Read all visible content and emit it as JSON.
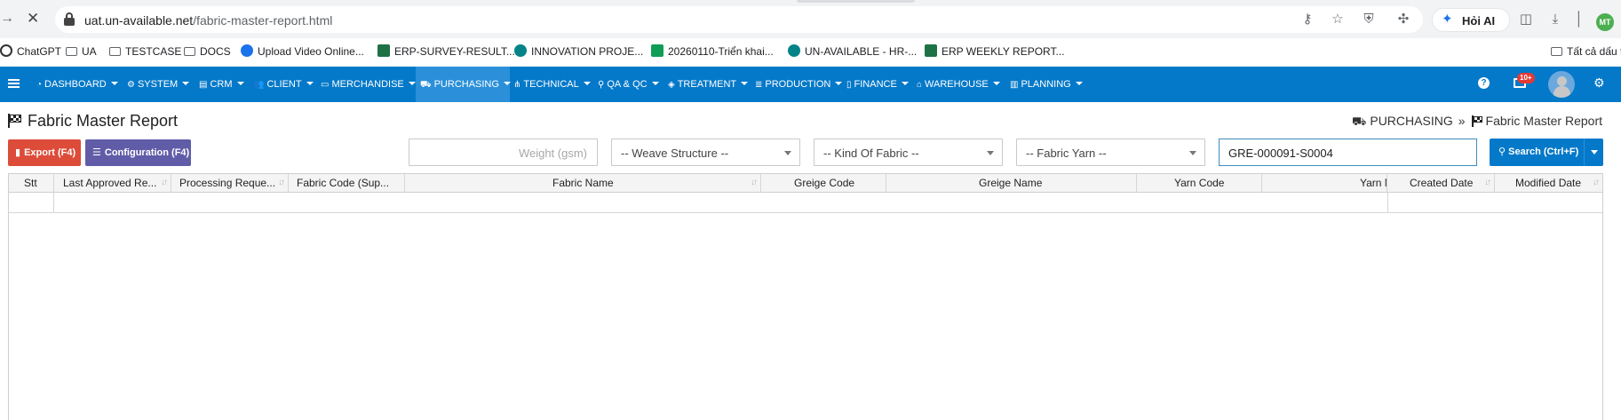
{
  "browser": {
    "url_host": "uat.un-available.net",
    "url_path": "/fabric-master-report.html",
    "ai_button_label": "Hỏi AI",
    "profile_initials": "MT",
    "icons": [
      "key-icon",
      "star-icon",
      "shield-icon",
      "extension-icon",
      "split-view-icon",
      "download-icon"
    ]
  },
  "bookmarks": [
    {
      "label": "ChatGPT",
      "icon": "chatgpt-icon"
    },
    {
      "label": "UA",
      "icon": "folder-icon"
    },
    {
      "label": "TESTCASE",
      "icon": "folder-icon"
    },
    {
      "label": "DOCS",
      "icon": "folder-icon"
    },
    {
      "label": "Upload Video Online...",
      "icon": "drive-icon"
    },
    {
      "label": "ERP-SURVEY-RESULT...",
      "icon": "excel-icon"
    },
    {
      "label": "INNOVATION PROJE...",
      "icon": "sharepoint-icon"
    },
    {
      "label": "20260110-Triển khai...",
      "icon": "sheets-icon"
    },
    {
      "label": "UN-AVAILABLE - HR-...",
      "icon": "sharepoint-icon"
    },
    {
      "label": "ERP WEEKLY REPORT...",
      "icon": "excel-icon"
    },
    {
      "label": "Tất cả dấu t",
      "icon": "folder-icon"
    }
  ],
  "nav": {
    "items": [
      {
        "label": "DASHBOARD"
      },
      {
        "label": "SYSTEM"
      },
      {
        "label": "CRM"
      },
      {
        "label": "CLIENT"
      },
      {
        "label": "MERCHANDISE"
      },
      {
        "label": "PURCHASING",
        "active": true
      },
      {
        "label": "TECHNICAL"
      },
      {
        "label": "QA & QC"
      },
      {
        "label": "TREATMENT"
      },
      {
        "label": "PRODUCTION"
      },
      {
        "label": "FINANCE"
      },
      {
        "label": "WAREHOUSE"
      },
      {
        "label": "PLANNING"
      }
    ],
    "notification_badge": "10+",
    "help_glyph": "?"
  },
  "page": {
    "title": "Fabric Master Report",
    "breadcrumb": {
      "parent": "PURCHASING",
      "separator": "»",
      "current": "Fabric Master Report"
    }
  },
  "toolbar": {
    "export_label": "Export (F4)",
    "config_label": "Configuration (F4)",
    "weight_placeholder": "Weight (gsm)",
    "weave_value": "-- Weave Structure --",
    "kind_value": "-- Kind Of Fabric --",
    "yarn_value": "-- Fabric Yarn --",
    "search_value": "GRE-000091-S0004",
    "search_label": "Search (Ctrl+F)"
  },
  "table": {
    "columns": [
      "Stt",
      "Last Approved Re...",
      "Processing Reque...",
      "Fabric Code (Sup...",
      "Fabric Name",
      "Greige Code",
      "Greige Name",
      "Yarn Code",
      "Yarn N",
      "Created Date",
      "Modified Date"
    ],
    "rows": []
  }
}
